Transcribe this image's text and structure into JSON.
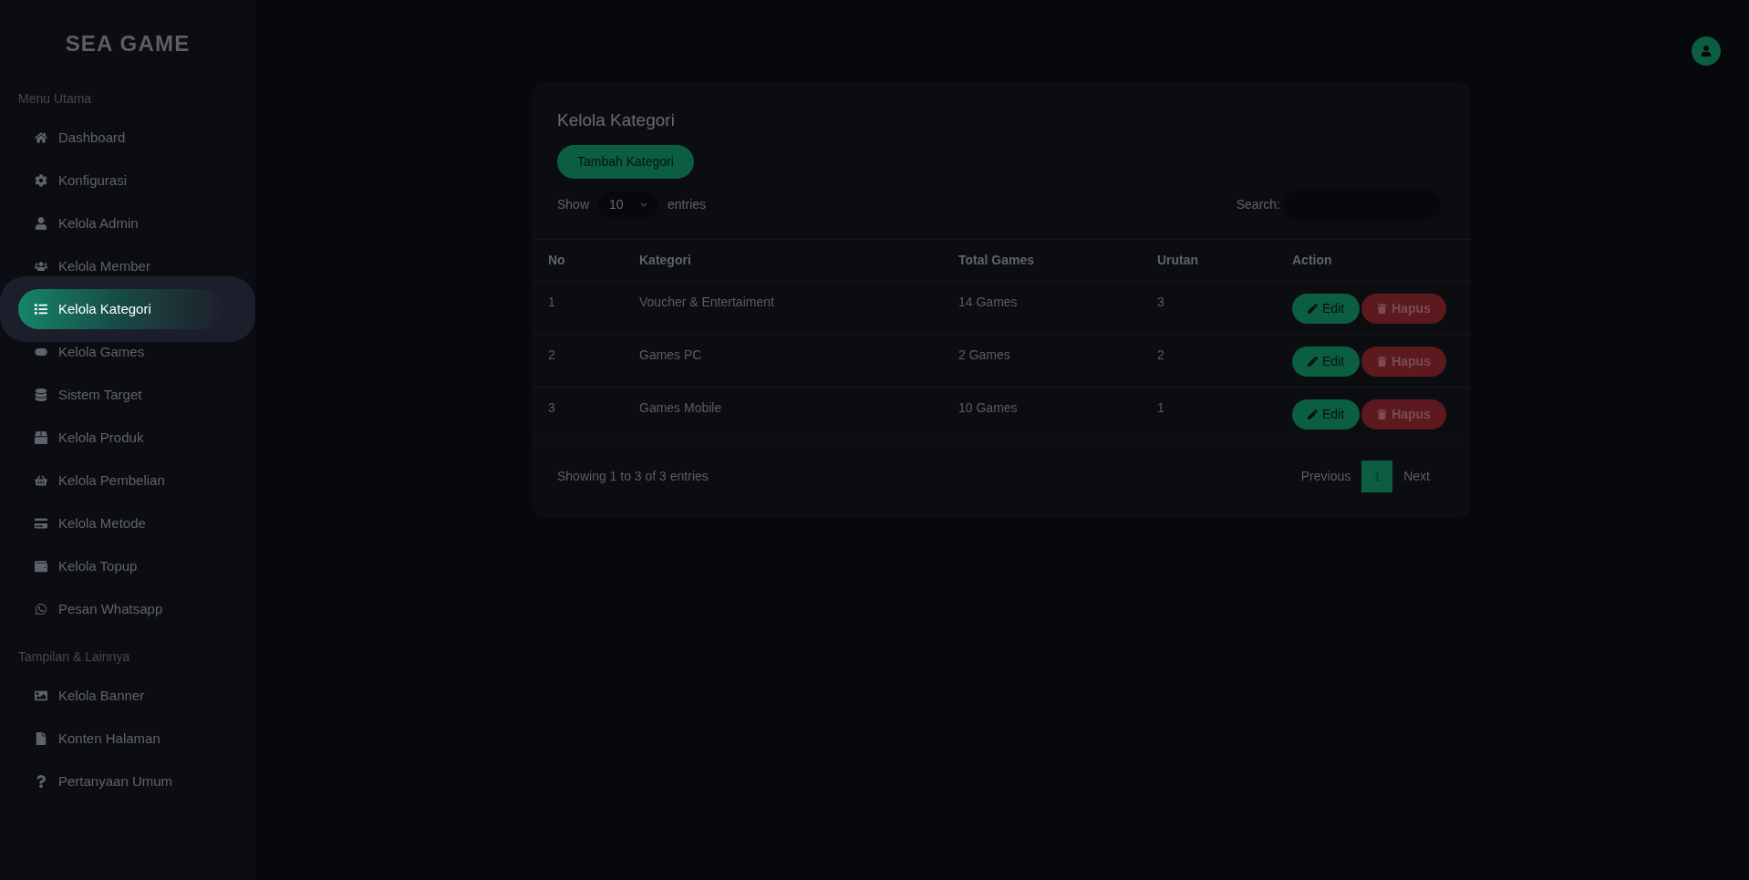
{
  "sidebar": {
    "logo": "SEA GAME",
    "sections": [
      {
        "heading": "Menu Utama",
        "items": [
          {
            "label": "Dashboard",
            "selected": false
          },
          {
            "label": "Konfigurasi",
            "selected": false
          },
          {
            "label": "Kelola Admin",
            "selected": false
          },
          {
            "label": "Kelola Member",
            "selected": false
          },
          {
            "label": "Kelola Kategori",
            "selected": true
          },
          {
            "label": "Kelola Games",
            "selected": false
          },
          {
            "label": "Sistem Target",
            "selected": false
          },
          {
            "label": "Kelola Produk",
            "selected": false
          },
          {
            "label": "Kelola Pembelian",
            "selected": false
          },
          {
            "label": "Kelola Metode",
            "selected": false
          },
          {
            "label": "Kelola Topup",
            "selected": false
          },
          {
            "label": "Pesan Whatsapp",
            "selected": false
          }
        ]
      },
      {
        "heading": "Tampilan & Lainnya",
        "items": [
          {
            "label": "Kelola Banner",
            "selected": false
          },
          {
            "label": "Konten Halaman",
            "selected": false
          },
          {
            "label": "Pertanyaan Umum",
            "selected": false
          }
        ]
      }
    ]
  },
  "card": {
    "title": "Kelola Kategori",
    "add_button": "Tambah Kategori",
    "length": {
      "show": "Show",
      "value": "10",
      "entries": "entries"
    },
    "search": {
      "label": "Search:"
    },
    "table": {
      "columns": [
        "No",
        "Kategori",
        "Total Games",
        "Urutan",
        "Action"
      ],
      "rows": [
        {
          "no": "1",
          "kategori": "Voucher & Entertaiment",
          "total": "14 Games",
          "urutan": "3",
          "edit": "Edit",
          "delete": "Hapus"
        },
        {
          "no": "2",
          "kategori": "Games PC",
          "total": "2 Games",
          "urutan": "2",
          "edit": "Edit",
          "delete": "Hapus"
        },
        {
          "no": "3",
          "kategori": "Games Mobile",
          "total": "10 Games",
          "urutan": "1",
          "edit": "Edit",
          "delete": "Hapus"
        }
      ]
    },
    "info": "Showing 1 to 3 of 3 entries",
    "pagination": {
      "previous": "Previous",
      "pages": [
        {
          "label": "1",
          "selected": true
        }
      ],
      "next": "Next"
    }
  }
}
